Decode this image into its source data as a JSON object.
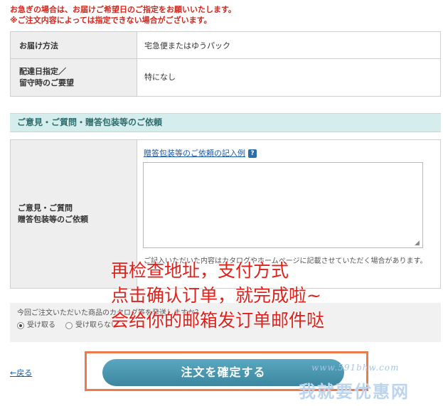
{
  "notice": {
    "line1": "お急ぎの場合は、お届けご希望日のご指定をお願いいたします。",
    "line2": "※ご注文内容によっては指定できない場合がございます。"
  },
  "delivery": {
    "method_label": "お届け方法",
    "method_value": "宅急便またはゆうパック",
    "date_label_line1": "配達日指定／",
    "date_label_line2": "留守時のご要望",
    "date_value": "特になし"
  },
  "comments": {
    "section_title": "ご意見・ご質問・贈答包装等のご依頼",
    "label_line1": "ご意見・ご質問",
    "label_line2": "贈答包装等のご依頼",
    "gift_link": "贈答包装等のご依頼の記入例",
    "help_glyph": "?",
    "textarea_value": "",
    "note_line1": "ご記入いただいた内容はカタログやホームページに記載させていただく",
    "note_line2": "場合があります。"
  },
  "catalog": {
    "question": "今回ご注文いただいた商品のカタログ等を発送しますか？",
    "option_receive": "受け取る",
    "option_decline": "受け取らない",
    "selected": "受け取る"
  },
  "navigation": {
    "back": "←戻る"
  },
  "confirm_button": "注文を確定する",
  "annotation": {
    "line1": "再检查地址，支付方式",
    "line2": "点击确认订单，就完成啦~",
    "line3": "会给你的邮箱发订单邮件哒"
  },
  "watermark": {
    "url": "www.591bhw.com",
    "site": "我就要优惠网"
  },
  "colors": {
    "notice_red": "#d0281e",
    "section_bg": "#d6eded",
    "button": "#3c879f",
    "annotation_red": "#e0211b",
    "frame_orange": "#ee7a4c"
  }
}
